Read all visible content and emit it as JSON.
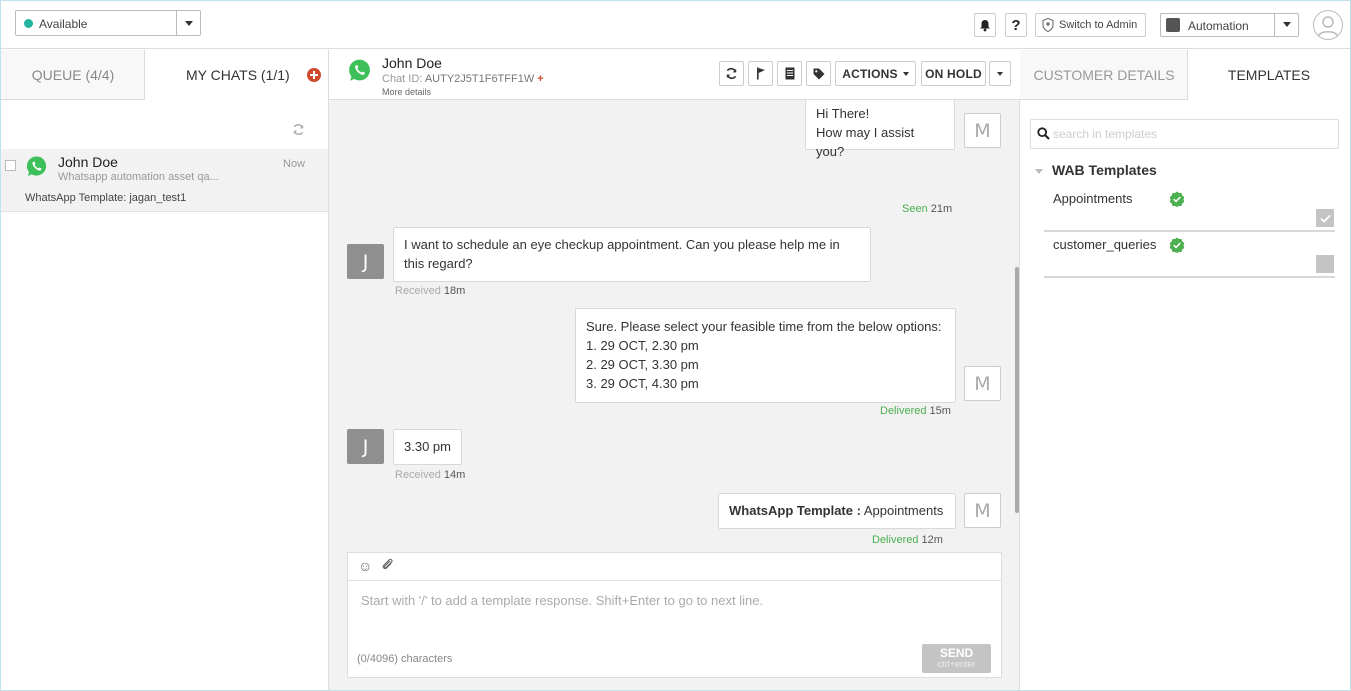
{
  "topbar": {
    "status": "Available",
    "switch_admin": "Switch to Admin",
    "automation": "Automation",
    "help_symbol": "?"
  },
  "left": {
    "tab_queue": "QUEUE (4/4)",
    "tab_my_chats": "MY CHATS (1/1)",
    "chat": {
      "name": "John Doe",
      "preview": "Whatsapp automation asset qa...",
      "time": "Now",
      "template": "WhatsApp Template: jagan_test1"
    }
  },
  "center": {
    "contact_name": "John Doe",
    "chat_id_label": "Chat ID:",
    "chat_id": "AUTY2J5T1F6TFF1W",
    "more_details": "More details",
    "actions_label": "ACTIONS",
    "on_hold_label": "ON HOLD",
    "messages": [
      {
        "line1": "Hi There!",
        "line2": "How may I assist you?",
        "status": "Seen",
        "time": "21m",
        "avatar": "M"
      },
      {
        "line1": "I want to schedule an eye checkup appointment. Can you please help me in",
        "line2": "this regard?",
        "status": "Received",
        "time": "18m",
        "avatar": "J"
      },
      {
        "line1": "Sure. Please select your feasible time from the below options:",
        "line2": "1. 29 OCT, 2.30 pm",
        "line3": "2. 29 OCT, 3.30 pm",
        "line4": "3. 29 OCT, 4.30 pm",
        "status": "Delivered",
        "time": "15m",
        "avatar": "M"
      },
      {
        "line1": "3.30 pm",
        "status": "Received",
        "time": "14m",
        "avatar": "J"
      },
      {
        "bold": "WhatsApp Template :",
        "line1": " Appointments",
        "status": "Delivered",
        "time": "12m",
        "avatar": "M"
      }
    ],
    "composer": {
      "placeholder": "Start with '/' to add a template response. Shift+Enter to go to next line.",
      "count": "(0/4096) characters",
      "send": "SEND",
      "send_hint": "ctrl+enter"
    }
  },
  "right": {
    "tab_customer": "CUSTOMER DETAILS",
    "tab_templates": "TEMPLATES",
    "search_placeholder": "search in templates",
    "group_title": "WAB Templates",
    "templates": [
      "Appointments",
      "customer_queries"
    ]
  },
  "colors": {
    "available": "#21b5a0",
    "whatsapp": "#3dbf5a",
    "delivered": "#4caf50",
    "add_red": "#d0492c"
  }
}
